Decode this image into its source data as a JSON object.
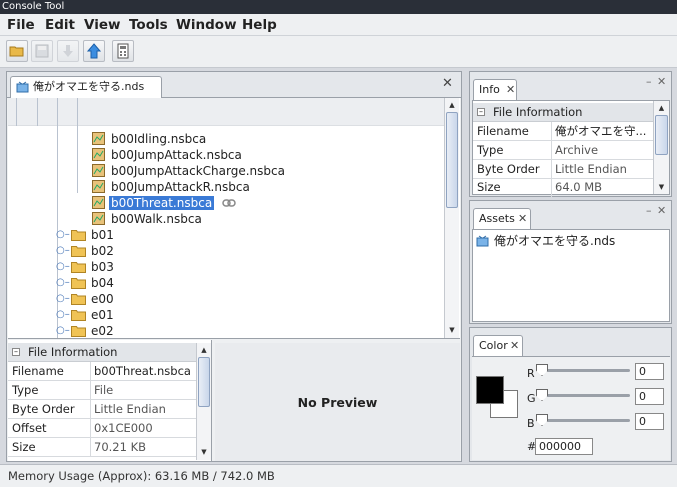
{
  "window": {
    "title": "Console Tool"
  },
  "menu": [
    "File",
    "Edit",
    "View",
    "Tools",
    "Window",
    "Help"
  ],
  "toolbar": {
    "icons": [
      "open-folder-icon",
      "save-icon",
      "download-arrow-icon",
      "upload-arrow-icon",
      "calculator-icon"
    ]
  },
  "main_tab": {
    "label": "俺がオマエを守る.nds"
  },
  "tree": {
    "files": [
      "b00Idling.nsbca",
      "b00JumpAttack.nsbca",
      "b00JumpAttackCharge.nsbca",
      "b00JumpAttackR.nsbca",
      "b00Threat.nsbca",
      "b00Walk.nsbca"
    ],
    "selected": "b00Threat.nsbca",
    "folders": [
      "b01",
      "b02",
      "b03",
      "b04",
      "e00",
      "e01",
      "e02"
    ]
  },
  "file_info": {
    "header": "File Information",
    "rows": [
      {
        "key": "Filename",
        "value": "b00Threat.nsbca"
      },
      {
        "key": "Type",
        "value": "File"
      },
      {
        "key": "Byte Order",
        "value": "Little Endian"
      },
      {
        "key": "Offset",
        "value": "0x1CE000"
      },
      {
        "key": "Size",
        "value": "70.21 KB"
      }
    ]
  },
  "preview": {
    "text": "No Preview"
  },
  "info_panel": {
    "tab": "Info",
    "header": "File Information",
    "rows": [
      {
        "key": "Filename",
        "value": "俺がオマエを守..."
      },
      {
        "key": "Type",
        "value": "Archive"
      },
      {
        "key": "Byte Order",
        "value": "Little Endian"
      },
      {
        "key": "Size",
        "value": "64.0 MB"
      }
    ]
  },
  "assets_panel": {
    "tab": "Assets",
    "item": "俺がオマエを守る.nds"
  },
  "color_panel": {
    "tab": "Color",
    "r_label": "R",
    "g_label": "G",
    "b_label": "B",
    "r_value": "0",
    "g_value": "0",
    "b_value": "0",
    "hash": "#",
    "hex": "000000",
    "foreground": "#000000",
    "background": "#ffffff"
  },
  "status": {
    "text": "Memory Usage (Approx): 63.16 MB / 742.0 MB"
  }
}
